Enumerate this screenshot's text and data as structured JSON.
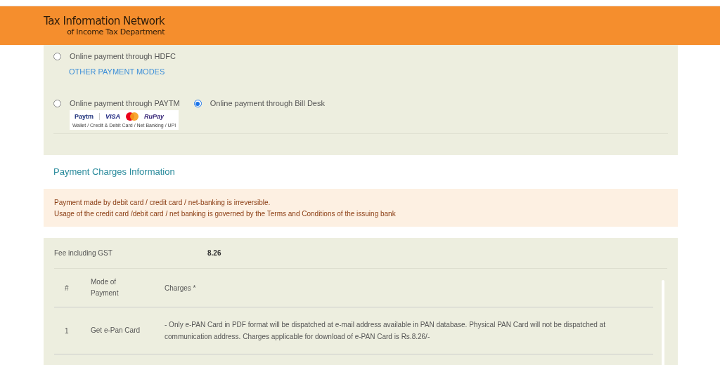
{
  "header": {
    "title": "Tax Information Network",
    "subtitle": "of Income Tax Department"
  },
  "payment_options": [
    {
      "label": "Online payment through HDFC",
      "selected": false,
      "kind": "plain"
    },
    {
      "kind": "link",
      "label": "OTHER PAYMENT MODES"
    },
    {
      "label": "Online payment through PAYTM",
      "selected": false,
      "kind": "paytm",
      "logos": [
        "Paytm",
        "VISA",
        "RuPay"
      ],
      "logo_caption": "Wallet / Credit & Debit Card / Net Banking / UPI"
    },
    {
      "label": "Online payment through Bill Desk",
      "selected": true,
      "kind": "plain"
    }
  ],
  "charges_section": {
    "title": "Payment Charges Information",
    "notices": [
      "Payment made by debit card / credit card / net-banking is irreversible.",
      "Usage of the credit card /debit card / net banking is governed by the Terms and Conditions of the issuing bank"
    ]
  },
  "fee": {
    "label": "Fee including GST",
    "value": "8.26"
  },
  "table": {
    "columns": [
      "#",
      "Mode of Payment",
      "Charges *"
    ],
    "rows": [
      [
        "1",
        "Get e-Pan Card",
        "- Only e-PAN Card in PDF format will be dispatched at e-mail address available in PAN database. Physical PAN Card will not be dispatched at communication address. Charges applicable for download of e-PAN Card is Rs.8.26/-"
      ]
    ]
  }
}
